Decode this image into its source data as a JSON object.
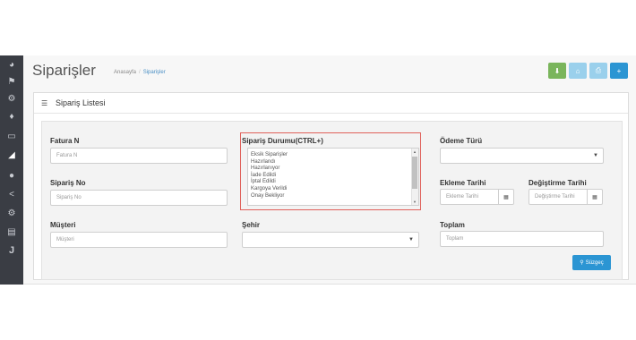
{
  "header": {
    "title": "Siparişler",
    "breadcrumb": [
      "Anasayfa",
      "Siparişler"
    ]
  },
  "toolbar": {
    "buttons": [
      {
        "name": "download-button",
        "icon": "download-icon",
        "color": "#7ab55c"
      },
      {
        "name": "home-button",
        "icon": "home-icon",
        "color": "#9ad0ec"
      },
      {
        "name": "print-button",
        "icon": "print-icon",
        "color": "#9ad0ec"
      },
      {
        "name": "add-button",
        "icon": "plus-icon",
        "color": "#2b95d3"
      }
    ]
  },
  "sidebar": {
    "icons": [
      "dashboard-icon",
      "tags-icon",
      "gear-icon",
      "puzzle-icon",
      "monitor-icon",
      "cart-icon",
      "user-icon",
      "share-icon",
      "gear-icon",
      "bar-chart-icon",
      "j-icon"
    ]
  },
  "panel": {
    "title": "Sipariş Listesi"
  },
  "filters": {
    "fatura_no": {
      "label": "Fatura N",
      "placeholder": "Fatura N"
    },
    "siparis_no": {
      "label": "Sipariş No",
      "placeholder": "Sipariş No"
    },
    "musteri": {
      "label": "Müşteri",
      "placeholder": "Müşteri"
    },
    "siparis_durumu": {
      "label": "Sipariş Durumu(CTRL+)",
      "options": [
        "Eksik Siparişler",
        "Hazırlandı",
        "Hazırlanıyor",
        "İade Edildi",
        "İptal Edildi",
        "Kargoya Verildi",
        "Onay Bekliyor"
      ]
    },
    "sehir": {
      "label": "Şehir",
      "value": ""
    },
    "odeme_turu": {
      "label": "Ödeme Türü",
      "value": ""
    },
    "ekleme_tarihi": {
      "label": "Ekleme Tarihi",
      "placeholder": "Ekleme Tarihi"
    },
    "degistirme_tarihi": {
      "label": "Değiştirme Tarihi",
      "placeholder": "Değiştirme Tarihi"
    },
    "toplam": {
      "label": "Toplam",
      "placeholder": "Toplam"
    }
  },
  "actions": {
    "search_label": "Süzgeç"
  },
  "colors": {
    "sidebar_bg": "#3a3d44",
    "accent": "#2b95d3",
    "highlight": "#e0605a"
  }
}
